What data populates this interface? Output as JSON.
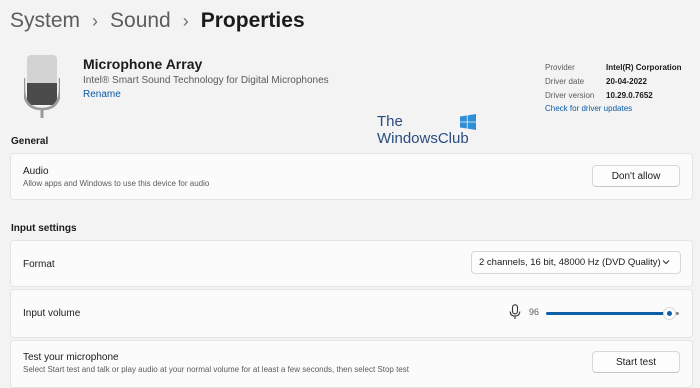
{
  "breadcrumb": {
    "items": [
      "System",
      "Sound"
    ],
    "current": "Properties",
    "separator": "›"
  },
  "device": {
    "name": "Microphone Array",
    "description": "Intel® Smart Sound Technology for Digital Microphones",
    "rename_label": "Rename",
    "icon": "microphone-device-icon"
  },
  "driver_info": {
    "provider_label": "Provider",
    "provider_value": "Intel(R) Corporation",
    "date_label": "Driver date",
    "date_value": "20-04-2022",
    "version_label": "Driver version",
    "version_value": "10.29.0.7652",
    "update_link": "Check for driver updates"
  },
  "watermark": {
    "line1": "The",
    "line2": "WindowsClub"
  },
  "general": {
    "title": "General",
    "audio": {
      "title": "Audio",
      "subtitle": "Allow apps and Windows to use this device for audio",
      "button": "Don't allow"
    }
  },
  "input_settings": {
    "title": "Input settings",
    "format": {
      "label": "Format",
      "value": "2 channels, 16 bit, 48000 Hz (DVD Quality)"
    },
    "volume": {
      "label": "Input volume",
      "value": "96",
      "level": 96,
      "icon": "microphone-icon"
    },
    "test": {
      "title": "Test your microphone",
      "subtitle": "Select Start test and talk or play audio at your normal volume for at least a few seconds, then select Stop test",
      "button": "Start test"
    }
  },
  "colors": {
    "accent": "#0d5fa8",
    "link": "#0b5aa6",
    "background": "#f3f3f3",
    "card": "#fbfbfb"
  }
}
